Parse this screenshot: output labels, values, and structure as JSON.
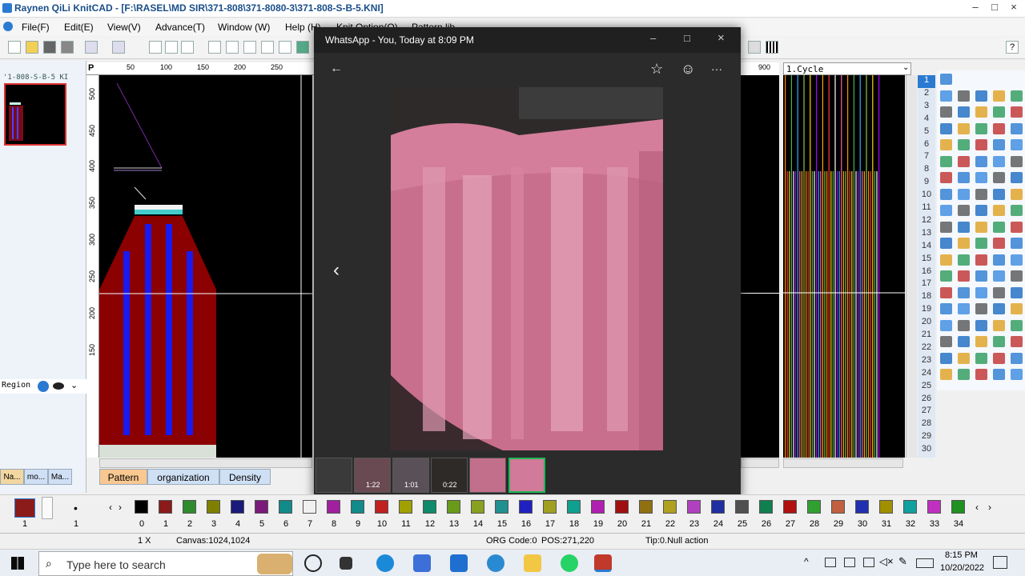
{
  "app": {
    "title": "Raynen QiLi KnitCAD - [F:\\RASEL\\MD SIR\\371-808\\371-8080-3\\371-808-S-B-5.KNI]",
    "window_controls": [
      "–",
      "□",
      "×"
    ]
  },
  "menu": [
    "File(F)",
    "Edit(E)",
    "View(V)",
    "Advance(T)",
    "Window (W)",
    "Help (H)",
    "Knit Option(O)",
    "Pattern lib"
  ],
  "left_panel": {
    "thumb_label": "'1-808-S-B-5 KI",
    "region_label": "Region"
  },
  "ruler_top": [
    "50",
    "100",
    "150",
    "200",
    "250"
  ],
  "ruler_left": [
    "500",
    "450",
    "400",
    "350",
    "300",
    "250",
    "200",
    "150"
  ],
  "right_ruler": "900",
  "cycle_select": "1.Cycle",
  "row_numbers": [
    "1",
    "2",
    "3",
    "4",
    "5",
    "6",
    "7",
    "8",
    "9",
    "10",
    "11",
    "12",
    "13",
    "14",
    "15",
    "16",
    "17",
    "18",
    "19",
    "20",
    "21",
    "22",
    "23",
    "24",
    "25",
    "26",
    "27",
    "28",
    "29",
    "30"
  ],
  "viewer": {
    "title": "WhatsApp - You, Today at 8:09 PM",
    "back": "←",
    "prev": "‹",
    "star": "☆",
    "emoji": "☺",
    "more": "···",
    "filmstrip": [
      {
        "label": "",
        "color": "#3a3a3a"
      },
      {
        "label": "1:22",
        "color": "#6a4a52"
      },
      {
        "label": "1:01",
        "color": "#5a5058"
      },
      {
        "label": "0:22",
        "color": "#2e2a28"
      },
      {
        "label": "",
        "color": "#c26f8c"
      },
      {
        "label": "",
        "color": "#d27a9a"
      }
    ]
  },
  "tabs": [
    "Na...",
    "mo...",
    "Ma...",
    "Pattern",
    "organization",
    "Density"
  ],
  "colorbar": {
    "left_items": [
      "1",
      "1"
    ],
    "swatches": [
      {
        "n": "0",
        "c": "#000000"
      },
      {
        "n": "1",
        "c": "#8b1a1a"
      },
      {
        "n": "2",
        "c": "#2e8b2e"
      },
      {
        "n": "3",
        "c": "#808000"
      },
      {
        "n": "4",
        "c": "#1a1a7a"
      },
      {
        "n": "5",
        "c": "#7a1a7a"
      },
      {
        "n": "6",
        "c": "#138a8a"
      },
      {
        "n": "7",
        "c": "#f0f0f0"
      },
      {
        "n": "8",
        "c": "#a020a0"
      },
      {
        "n": "9",
        "c": "#138a8a"
      },
      {
        "n": "10",
        "c": "#c02020"
      },
      {
        "n": "11",
        "c": "#a0a000"
      },
      {
        "n": "12",
        "c": "#0f8a6a"
      },
      {
        "n": "13",
        "c": "#6a9a1a"
      },
      {
        "n": "14",
        "c": "#8aa020"
      },
      {
        "n": "15",
        "c": "#209090"
      },
      {
        "n": "16",
        "c": "#2020c0"
      },
      {
        "n": "17",
        "c": "#a0a020"
      },
      {
        "n": "18",
        "c": "#10a090"
      },
      {
        "n": "19",
        "c": "#b020b0"
      },
      {
        "n": "20",
        "c": "#a01010"
      },
      {
        "n": "21",
        "c": "#907010"
      },
      {
        "n": "22",
        "c": "#b0a020"
      },
      {
        "n": "23",
        "c": "#b040c0"
      },
      {
        "n": "24",
        "c": "#2030a0"
      },
      {
        "n": "25",
        "c": "#505050"
      },
      {
        "n": "26",
        "c": "#108050"
      },
      {
        "n": "27",
        "c": "#b01010"
      },
      {
        "n": "28",
        "c": "#30a030"
      },
      {
        "n": "29",
        "c": "#c06040"
      },
      {
        "n": "30",
        "c": "#2030b0"
      },
      {
        "n": "31",
        "c": "#a09000"
      },
      {
        "n": "32",
        "c": "#10a0a0"
      },
      {
        "n": "33",
        "c": "#c030c0"
      },
      {
        "n": "34",
        "c": "#209020"
      }
    ]
  },
  "status": {
    "zoom": "1 X",
    "canvas": "Canvas:1024,1024",
    "org": "ORG Code:0",
    "pos": "POS:271,220",
    "tip": "Tip:0.Null action"
  },
  "taskbar": {
    "search_placeholder": "Type here to search",
    "time": "8:15 PM",
    "date": "10/20/2022",
    "apps": [
      "task-view",
      "edge",
      "store",
      "mail",
      "qili",
      "explorer",
      "whatsapp",
      "knitcad"
    ]
  }
}
